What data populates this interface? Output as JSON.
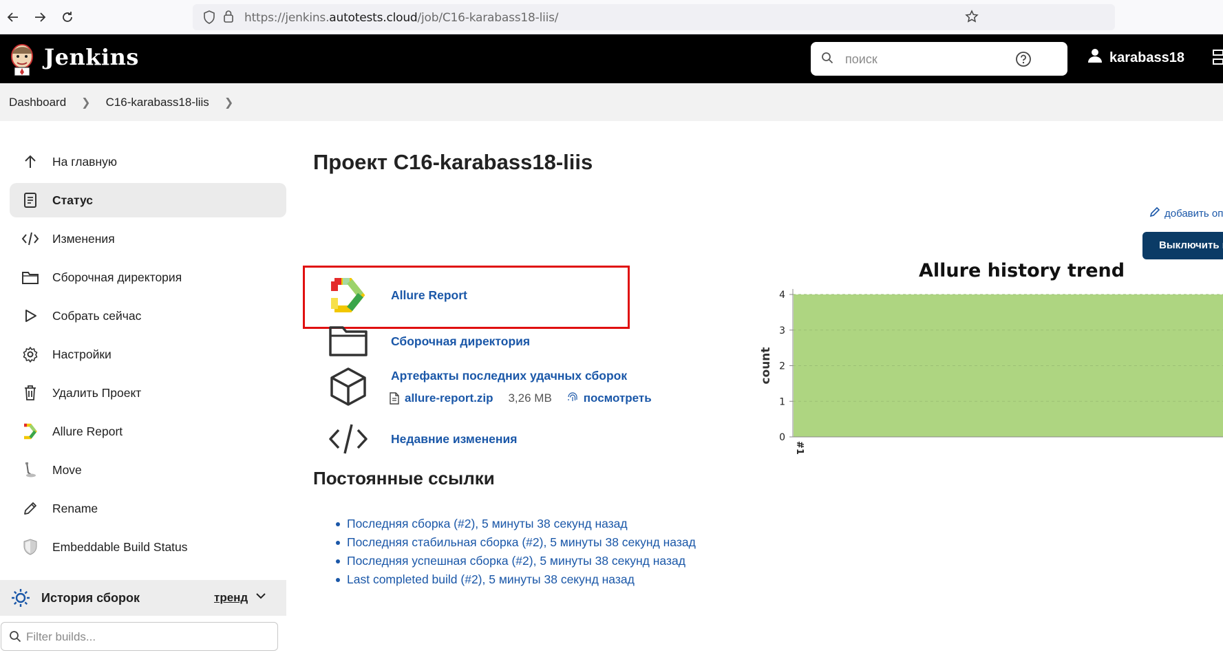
{
  "browser": {
    "url_prefix": "https://jenkins.",
    "url_domain": "autotests.cloud",
    "url_path": "/job/C16-karabass18-liis/"
  },
  "header": {
    "app_title": "Jenkins",
    "search_placeholder": "поиск",
    "username": "karabass18"
  },
  "breadcrumb": {
    "items": [
      "Dashboard",
      "C16-karabass18-liis"
    ]
  },
  "sidebar": {
    "items": [
      {
        "label": "На главную",
        "icon": "arrow-up-icon"
      },
      {
        "label": "Статус",
        "icon": "document-icon",
        "active": true
      },
      {
        "label": "Изменения",
        "icon": "code-icon"
      },
      {
        "label": "Сборочная директория",
        "icon": "folder-icon"
      },
      {
        "label": "Собрать сейчас",
        "icon": "play-icon"
      },
      {
        "label": "Настройки",
        "icon": "gear-icon"
      },
      {
        "label": "Удалить Проект",
        "icon": "trash-icon"
      },
      {
        "label": "Allure Report",
        "icon": "allure-icon"
      },
      {
        "label": "Move",
        "icon": "move-icon"
      },
      {
        "label": "Rename",
        "icon": "pencil-icon"
      },
      {
        "label": "Embeddable Build Status",
        "icon": "shield-icon"
      }
    ],
    "history": {
      "label": "История сборок",
      "trend_label": "тренд"
    },
    "filter_placeholder": "Filter builds..."
  },
  "main": {
    "title": "Проект C16-karabass18-liis",
    "add_description": "добавить оп",
    "disable_button": "Выключить п",
    "actions": {
      "allure": "Allure Report",
      "workspace": "Сборочная директория",
      "artifacts": "Артефакты последних удачных сборок",
      "artifact_file": "allure-report.zip",
      "artifact_size": "3,26 MB",
      "artifact_view": "посмотреть",
      "recent_changes": "Недавние изменения"
    },
    "permalinks_title": "Постоянные ссылки",
    "permalinks": [
      "Последняя сборка (#2), 5 минуты 38 секунд назад",
      "Последняя стабильная сборка (#2), 5 минуты 38 секунд назад",
      "Последняя успешная сборка (#2), 5 минуты 38 секунд назад",
      "Last completed build (#2), 5 минуты 38 секунд назад"
    ]
  },
  "colors": {
    "header_bg": "#000000",
    "link": "#1a57a8",
    "highlight": "#e01010",
    "chart_fill": "#aed581",
    "disable_button_bg": "#0b3b66"
  },
  "chart_data": {
    "type": "area",
    "title": "Allure history trend",
    "ylabel": "count",
    "xlabel": "",
    "x": [
      "#1"
    ],
    "yticks": [
      "0",
      "1",
      "2",
      "3",
      "4"
    ],
    "ylim": [
      0,
      4
    ],
    "series": [
      {
        "values": [
          4
        ],
        "color": "#aed581"
      }
    ],
    "grid": true
  }
}
